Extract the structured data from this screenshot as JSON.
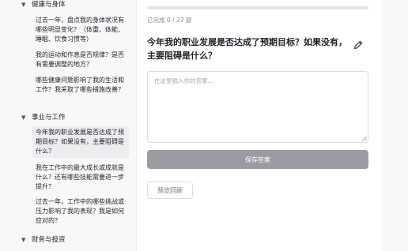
{
  "sidebar": {
    "groups": [
      {
        "title": "健康与身体",
        "items": [
          "过去一年，盘点我的身体状况有哪些明显变化？（体重、体能、睡眠、饮食习惯等）",
          "我的运动和作息是否规律？是否有需要调整的地方？",
          "哪些健康问题影响了我的生活和工作？我采取了哪些措施改善？"
        ]
      },
      {
        "title": "事业与工作",
        "items": [
          "今年我的职业发展是否达成了预期目标？如果没有，主要阻碍是什么？",
          "我在工作中的最大成长或成就是什么？还有哪些技能需要进一步提升？",
          "过去一年，工作中的哪些挑战或压力影响了我的表现？我是如何应对的？"
        ]
      },
      {
        "title": "财务与投资",
        "items": []
      }
    ]
  },
  "progress": {
    "label": "已完成 0 / 27 题",
    "fraction": 0
  },
  "question": {
    "title": "今年我的职业发展是否达成了预期目标？如果没有，主要阻碍是什么？"
  },
  "answer": {
    "value": "",
    "placeholder": "在这里输入你的答案..."
  },
  "buttons": {
    "save_label": "保存答案",
    "preview_label": "预览回顾"
  },
  "icons": {
    "edit": "pencil-icon",
    "chevron": "chevron-down-icon"
  },
  "colors": {
    "save_button": "#9a9ca1",
    "active_item": "#ededf0"
  }
}
